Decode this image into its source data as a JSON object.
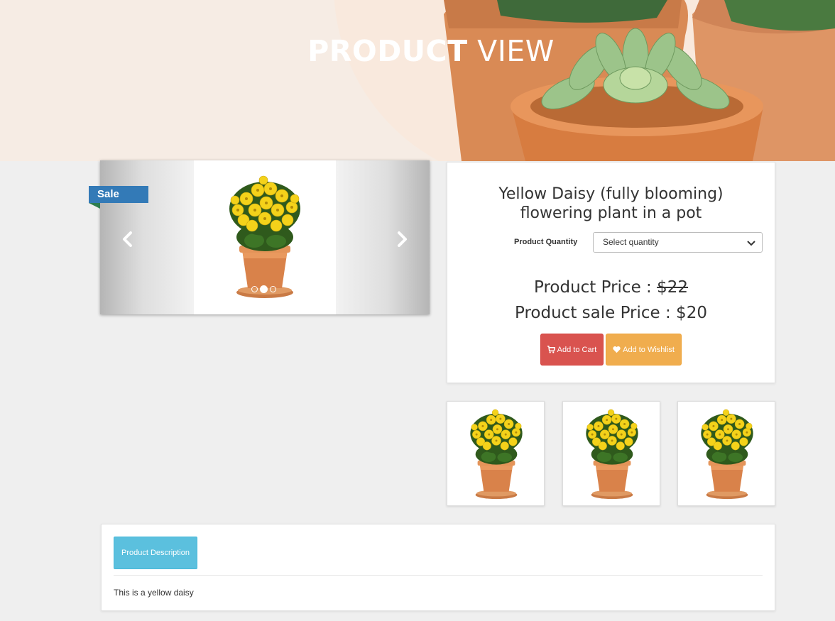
{
  "hero": {
    "title_bold": "PRODUCT",
    "title_light": "VIEW"
  },
  "carousel": {
    "badge": "Sale",
    "slide_count": 3,
    "active_slide": 2
  },
  "product": {
    "title": "Yellow Daisy (fully blooming) flowering plant in a pot",
    "quantity_label": "Product Quantity",
    "quantity_placeholder": "Select quantity",
    "price_label": "Product Price : ",
    "price_original": "$22",
    "sale_price_text": "Product sale Price : $20",
    "add_to_cart": "Add to Cart",
    "add_to_wishlist": "Add to Wishlist"
  },
  "thumbnails": [
    {
      "icon": "flower-pot-image"
    },
    {
      "icon": "flower-pot-image"
    },
    {
      "icon": "flower-pot-image"
    }
  ],
  "description": {
    "tab_label": "Product Description",
    "text": "This is a yellow daisy"
  },
  "colors": {
    "sale_badge": "#337ab7",
    "cart_button": "#d9534f",
    "wishlist_button": "#f0ad4e",
    "description_tab": "#5bc0de",
    "page_background": "#efefef"
  }
}
